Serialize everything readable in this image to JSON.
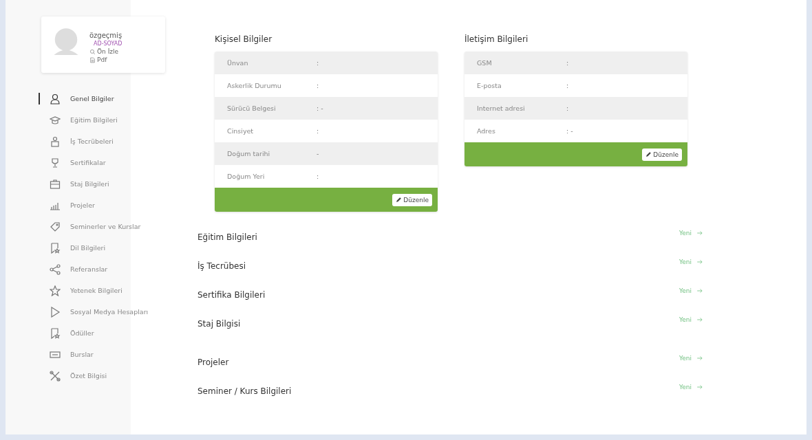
{
  "profile": {
    "title": "özgeçmiş",
    "name": "AD-SOYAD",
    "actions": [
      {
        "label": "Ön İzle"
      },
      {
        "label": "Pdf"
      }
    ]
  },
  "sidebar": {
    "items": [
      {
        "label": "Genel Bilgiler",
        "selected": true
      },
      {
        "label": "Eğitim Bilgileri",
        "selected": false
      },
      {
        "label": "İş Tecrübeleri",
        "selected": false
      },
      {
        "label": "Sertifikalar",
        "selected": false
      },
      {
        "label": "Staj Bilgileri",
        "selected": false
      },
      {
        "label": "Projeler",
        "selected": false
      },
      {
        "label": "Seminerler ve Kurslar",
        "selected": false
      },
      {
        "label": "Dil Bilgileri",
        "selected": false
      },
      {
        "label": "Referanslar",
        "selected": false
      },
      {
        "label": "Yetenek Bilgileri",
        "selected": false
      },
      {
        "label": "Sosyal Medya Hesapları",
        "selected": false
      },
      {
        "label": "Ödüller",
        "selected": false
      },
      {
        "label": "Burslar",
        "selected": false
      },
      {
        "label": "Özet Bilgisi",
        "selected": false
      }
    ]
  },
  "cards": [
    {
      "title": "Kişisel Bilgiler",
      "rows": [
        {
          "label": "Ünvan",
          "value": ":"
        },
        {
          "label": "Askerlik Durumu",
          "value": ":"
        },
        {
          "label": "Sürücü Belgesi",
          "value": ": -"
        },
        {
          "label": "Cinsiyet",
          "value": ":"
        },
        {
          "label": "Doğum tarihi",
          "value": "-"
        },
        {
          "label": "Doğum Yeri",
          "value": ":"
        }
      ],
      "button": "Düzenle"
    },
    {
      "title": "İletişim Bilgileri",
      "rows": [
        {
          "label": "GSM",
          "value": ":"
        },
        {
          "label": "E-posta",
          "value": ":"
        },
        {
          "label": "Internet adresi",
          "value": ":"
        },
        {
          "label": "Adres",
          "value": ": -"
        }
      ],
      "button": "Düzenle"
    }
  ],
  "sections": [
    {
      "title": "Eğitim Bilgileri",
      "action": "Yeni"
    },
    {
      "title": "İş Tecrübesi",
      "action": "Yeni"
    },
    {
      "title": "Sertifika Bilgileri",
      "action": "Yeni"
    },
    {
      "title": "Staj Bilgisi",
      "action": "Yeni"
    },
    {
      "title": "Projeler",
      "action": "Yeni"
    },
    {
      "title": "Seminer / Kurs Bilgileri",
      "action": "Yeni"
    }
  ]
}
